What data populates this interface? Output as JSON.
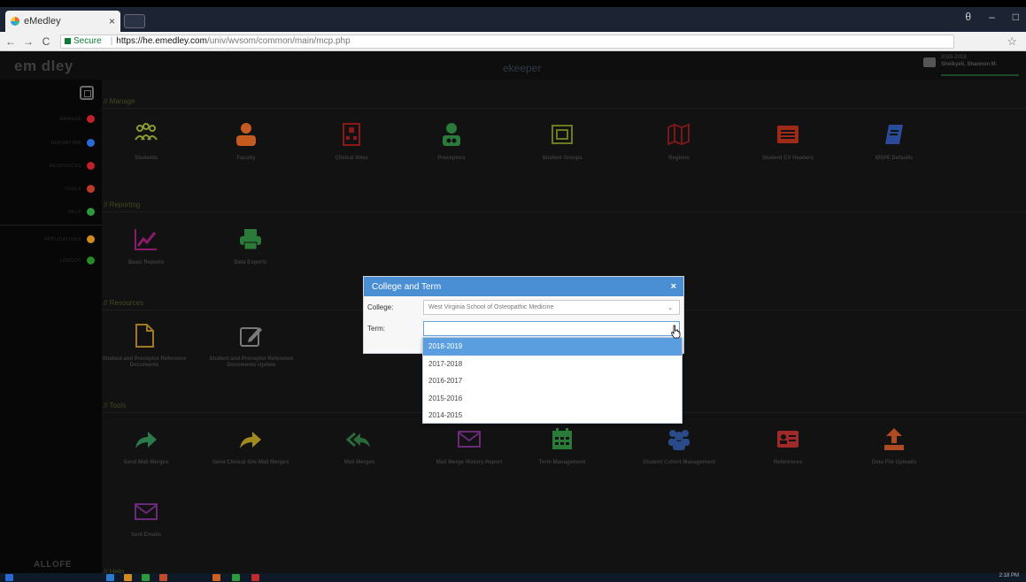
{
  "browser": {
    "tab_title": "eMedley",
    "tab_close": "×",
    "url_secure": "Secure",
    "url_host": "https://he.emedley.com",
    "url_path": "/univ/wvsom/common/main/mcp.php",
    "back": "←",
    "forward": "→",
    "reload": "C",
    "bookmark": "☆",
    "win_account": "θ",
    "win_min": "–",
    "win_max": "□"
  },
  "app": {
    "logo": "em  dley",
    "title": "ekeeper",
    "user_term": "2018-2019",
    "user_name": "Sheikyeli, Shannon M."
  },
  "sidebar": {
    "items": [
      {
        "label": "MANAGE",
        "color": "#c0202a"
      },
      {
        "label": "REPORTING",
        "color": "#2a6ad4"
      },
      {
        "label": "RESOURCES",
        "color": "#c0202a"
      },
      {
        "label": "TOOLS",
        "color": "#c03a2a"
      },
      {
        "label": "HELP",
        "color": "#2a9a3a"
      },
      {
        "label": "APPLICATIONS",
        "color": "#d08a20"
      },
      {
        "label": "LOGOUT",
        "color": "#2a8a2a"
      }
    ],
    "footer": "ALLOFE"
  },
  "sections": {
    "manage": "// Manage",
    "reporting": "// Reporting",
    "resources": "// Resources",
    "tools": "// Tools",
    "help": "// Help"
  },
  "manage_tiles": [
    {
      "label": "Students",
      "icon": "students-icon",
      "color": "#8a9a30"
    },
    {
      "label": "Faculty",
      "icon": "faculty-icon",
      "color": "#c45a20"
    },
    {
      "label": "Clinical Sites",
      "icon": "hospital-icon",
      "color": "#8a1a1a"
    },
    {
      "label": "Preceptors",
      "icon": "doctor-icon",
      "color": "#2a7a3a"
    },
    {
      "label": "Student Groups",
      "icon": "groups-icon",
      "color": "#6a7a20"
    },
    {
      "label": "Regions",
      "icon": "map-icon",
      "color": "#7a1818"
    },
    {
      "label": "Student CV Headers",
      "icon": "list-icon",
      "color": "#a02a1a"
    },
    {
      "label": "MSPE Defaults",
      "icon": "book-icon",
      "color": "#2a4a9a"
    }
  ],
  "reporting_tiles": [
    {
      "label": "Basic Reports",
      "icon": "chart-icon",
      "color": "#8a1a6a"
    },
    {
      "label": "Data Exports",
      "icon": "printer-icon",
      "color": "#2a7a3a"
    }
  ],
  "resources_tiles": [
    {
      "label": "Student and Preceptor Reference Documents",
      "icon": "document-icon",
      "color": "#a07a20"
    },
    {
      "label": "Student and Preceptor Reference Documents Update",
      "icon": "edit-icon",
      "color": "#7a7a7a"
    }
  ],
  "tools_tiles": [
    {
      "label": "Send Mail Merges",
      "icon": "share-icon",
      "color": "#2a7a4a"
    },
    {
      "label": "Send Clinical Site Mail Merges",
      "icon": "share-icon",
      "color": "#a08a20"
    },
    {
      "label": "Mail Merges",
      "icon": "reply-all-icon",
      "color": "#2a6a3a"
    },
    {
      "label": "Mail Merge History Report",
      "icon": "envelope-icon",
      "color": "#6a2a7a"
    },
    {
      "label": "Term Management",
      "icon": "calendar-icon",
      "color": "#2a7a3a"
    },
    {
      "label": "Student Cohort Management",
      "icon": "users-icon",
      "color": "#2a4a8a"
    },
    {
      "label": "References",
      "icon": "id-card-icon",
      "color": "#a02a2a"
    },
    {
      "label": "Data File Uploads",
      "icon": "upload-icon",
      "color": "#b04a20"
    },
    {
      "label": "Sent Emails",
      "icon": "envelope-icon",
      "color": "#6a2a7a"
    }
  ],
  "dialog": {
    "title": "College and Term",
    "close": "×",
    "college_label": "College:",
    "college_value": "West Virginia School of Osteopathic Medicine",
    "term_label": "Term:",
    "term_value": "",
    "caret": "⌄",
    "term_options": [
      "2018-2019",
      "2017-2018",
      "2016-2017",
      "2015-2016",
      "2014-2015"
    ],
    "selected_index": 0
  },
  "taskbar": {
    "time": "2:18 PM"
  }
}
